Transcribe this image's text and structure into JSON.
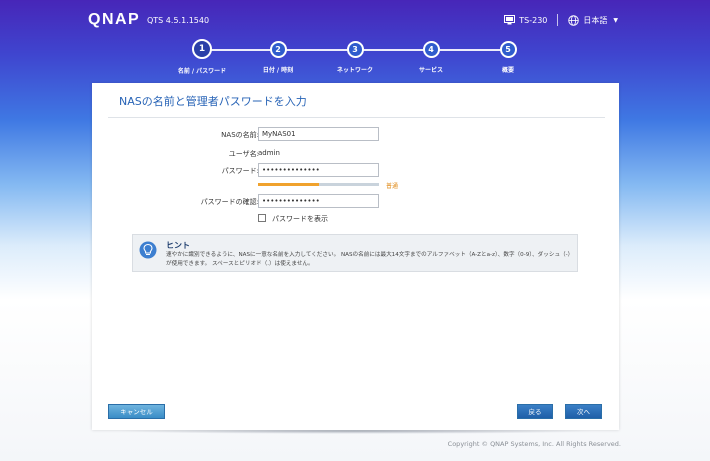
{
  "header": {
    "logo": "QNAP",
    "version": "QTS 4.5.1.1540",
    "device_name": "TS-230",
    "language": "日本語"
  },
  "steps": [
    {
      "number": "1",
      "label": "名前 / パスワード",
      "active": true
    },
    {
      "number": "2",
      "label": "日付 / 時刻",
      "active": false
    },
    {
      "number": "3",
      "label": "ネットワーク",
      "active": false
    },
    {
      "number": "4",
      "label": "サービス",
      "active": false
    },
    {
      "number": "5",
      "label": "概要",
      "active": false
    }
  ],
  "panel": {
    "title": "NASの名前と管理者パスワードを入力",
    "nas_name_label": "NASの名前:",
    "nas_name_value": "MyNAS01",
    "username_label": "ユーザ名:",
    "username_value": "admin",
    "password_label": "パスワード:",
    "password_value": "••••••••••••••",
    "strength_label": "普通",
    "strength_level": 0.5,
    "confirm_label": "パスワードの確認:",
    "confirm_value": "••••••••••••••",
    "show_password_label": "パスワードを表示",
    "show_password_checked": false
  },
  "hint": {
    "title": "ヒント",
    "text": "速やかに識別できるように、NASに一意な名前を入力してください。 NASの名前には最大14文字までのアルファベット（A-Zとa-z）、数字（0-9）、ダッシュ（-）が使用できます。 スペースとピリオド（.）は使えません。"
  },
  "buttons": {
    "cancel": "キャンセル",
    "back": "戻る",
    "next": "次へ"
  },
  "footer": {
    "copyright": "Copyright © QNAP Systems, Inc. All Rights Reserved."
  },
  "colors": {
    "accent": "#2763b6",
    "strength": "#f0a22d"
  }
}
